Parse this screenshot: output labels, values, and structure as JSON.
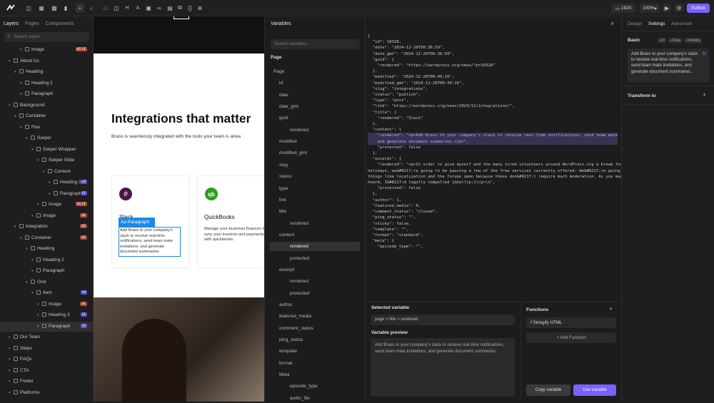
{
  "toolbar": {
    "width_value": "1920",
    "zoom_value": "100%",
    "publish_label": "Publish"
  },
  "left_panel": {
    "tabs": [
      "Layers",
      "Pages",
      "Components"
    ],
    "search_placeholder": "Search layers",
    "rows": [
      {
        "label": "Image",
        "badge": "a1 c1"
      },
      {
        "label": "About Us",
        "badge": ""
      },
      {
        "label": "Heading",
        "badge": ""
      },
      {
        "label": "Heading 2",
        "badge": ""
      },
      {
        "label": "Paragraph",
        "badge": ""
      },
      {
        "label": "Background",
        "badge": ""
      },
      {
        "label": "Container",
        "badge": ""
      },
      {
        "label": "Flex",
        "badge": ""
      },
      {
        "label": "Swiper",
        "badge": ""
      },
      {
        "label": "Swiper Wrapper",
        "badge": ""
      },
      {
        "label": "Swiper Slide",
        "badge": ""
      },
      {
        "label": "Content",
        "badge": ""
      },
      {
        "label": "Heading 3",
        "badge": "c2"
      },
      {
        "label": "Paragraph",
        "badge": "c1"
      },
      {
        "label": "Image",
        "badge": "a1 c1"
      },
      {
        "label": "Image",
        "badge": "a1"
      },
      {
        "label": "Integration",
        "badge": "a1"
      },
      {
        "label": "Container",
        "badge": "a1"
      },
      {
        "label": "Heading",
        "badge": ""
      },
      {
        "label": "Heading 2",
        "badge": ""
      },
      {
        "label": "Paragraph",
        "badge": ""
      },
      {
        "label": "Grid",
        "badge": ""
      },
      {
        "label": "Item",
        "badge": "c4"
      },
      {
        "label": "Image",
        "badge": "a1"
      },
      {
        "label": "Heading 3",
        "badge": "c1"
      },
      {
        "label": "Paragraph",
        "badge": "c2"
      },
      {
        "label": "Our Team",
        "badge": ""
      },
      {
        "label": "Steps",
        "badge": ""
      },
      {
        "label": "FAQs",
        "badge": ""
      },
      {
        "label": "CTA",
        "badge": ""
      },
      {
        "label": "Footer",
        "badge": ""
      },
      {
        "label": "Platforms",
        "badge": ""
      }
    ]
  },
  "canvas": {
    "heading": "Integrations that matter",
    "subtext": "Brass is seamlessly integrated with the tools your team is alrea",
    "card1": {
      "title": "Slack",
      "text": "Add Brass to your company's slack to receive real-time notifications, send team mate invitations, and generate document summaries."
    },
    "card2": {
      "title": "QuickBooks",
      "text": "Manage your business finances by sync your invoices and payments with quickbooks."
    },
    "tag_label": "Paragraph"
  },
  "variables": {
    "title": "Variables",
    "search_placeholder": "Search variables...",
    "section": "Page",
    "items": [
      {
        "label": "Page",
        "indent": 0
      },
      {
        "label": "id",
        "indent": 1
      },
      {
        "label": "date",
        "indent": 1
      },
      {
        "label": "date_gmt",
        "indent": 1
      },
      {
        "label": "guid",
        "indent": 1
      },
      {
        "label": "rendered",
        "indent": 2
      },
      {
        "label": "modified",
        "indent": 1
      },
      {
        "label": "modified_gmt",
        "indent": 1
      },
      {
        "label": "slug",
        "indent": 1
      },
      {
        "label": "status",
        "indent": 1
      },
      {
        "label": "type",
        "indent": 1
      },
      {
        "label": "link",
        "indent": 1
      },
      {
        "label": "title",
        "indent": 1
      },
      {
        "label": "rendered",
        "indent": 2
      },
      {
        "label": "content",
        "indent": 1
      },
      {
        "label": "rendered",
        "indent": 2
      },
      {
        "label": "protected",
        "indent": 2
      },
      {
        "label": "excerpt",
        "indent": 1
      },
      {
        "label": "rendered",
        "indent": 2
      },
      {
        "label": "protected",
        "indent": 2
      },
      {
        "label": "author",
        "indent": 1
      },
      {
        "label": "featured_media",
        "indent": 1
      },
      {
        "label": "comment_status",
        "indent": 1
      },
      {
        "label": "ping_status",
        "indent": 1
      },
      {
        "label": "template",
        "indent": 1
      },
      {
        "label": "format",
        "indent": 1
      },
      {
        "label": "Meta",
        "indent": 1
      },
      {
        "label": "episode_type",
        "indent": 2
      },
      {
        "label": "audio_file",
        "indent": 2
      }
    ],
    "json_lines": [
      "{",
      "  \"id\": 18328,",
      "  \"date\": \"2024-12-20T00:36:59\",",
      "  \"date_gmt\": \"2024-12-20T00:36:59\",",
      "  \"guid\": {",
      "    \"rendered\": \"https://wordpress.org/news/?p=18328\"",
      "  },",
      "  \"modified\": \"2024-12-20T00:49:16\",",
      "  \"modified_gmt\": \"2024-12-20T00:49:16\",",
      "  \"slug\": \"integrations\",",
      "  \"status\": \"publish\",",
      "  \"type\": \"post\",",
      "  \"link\": \"https://wordpress.org/news/2024/12/integrations/\",",
      "  \"title\": {",
      "    \"rendered\": \"Slack\"",
      "  },",
      "  \"content\": {",
      "    \"rendered\": \"<p>Add Brass to your company's slack to receive real-time notifications, send team mate invitations,",
      "    and generate document summaries.</p>\",",
      "    \"protected\": false",
      "  },",
      "  \"excerpt\": {",
      "    \"rendered\": \"<p>In order to give myself and the many tired volunteers around WordPress.org a break for the",
      "holidays, we&#8217;re going to be pausing a few of the free services currently offered: We&#8217;re going to leave",
      "things like localization and the forums open because these don&#8217;t require much moderation. As you may have",
      "heard, I&#8217;m legally compelled [&hellip;]</p>\\n\",",
      "    \"protected\": false",
      "  },",
      "  \"author\": 1,",
      "  \"featured_media\": 0,",
      "  \"comment_status\": \"closed\",",
      "  \"ping_status\": \"\",",
      "  \"sticky\": false,",
      "  \"template\": \"\",",
      "  \"format\": \"standard\",",
      "  \"meta\": {",
      "    \"episode_type\": \"\","
    ],
    "selected_label": "Selected variable",
    "selected_value": "page > title > rendered",
    "preview_label": "Variable preview",
    "preview_text": "Add Brass to your company's slack to receive real-time notifications, send team mate invitations, and generate document summaries.",
    "functions_label": "Functions",
    "function_item": "Stringify HTML",
    "add_function": "Add Function",
    "copy_label": "Copy variable",
    "use_label": "Use variable"
  },
  "right_panel": {
    "tabs": [
      "Design",
      "Settings",
      "Advanced"
    ],
    "basic_label": "Basic",
    "chips": [
      "+ID",
      "+Class",
      "+Visibility"
    ],
    "text_value": "Add Brass to your company's slack to receive real-time notifications, send team mate invitations, and generate document summaries.",
    "transform_label": "Transform to"
  },
  "colors": {
    "accent": "#7b61ff",
    "tag": "#1e88e5",
    "badge_purple": "#5b4dd6",
    "badge_red": "#b2463c"
  }
}
